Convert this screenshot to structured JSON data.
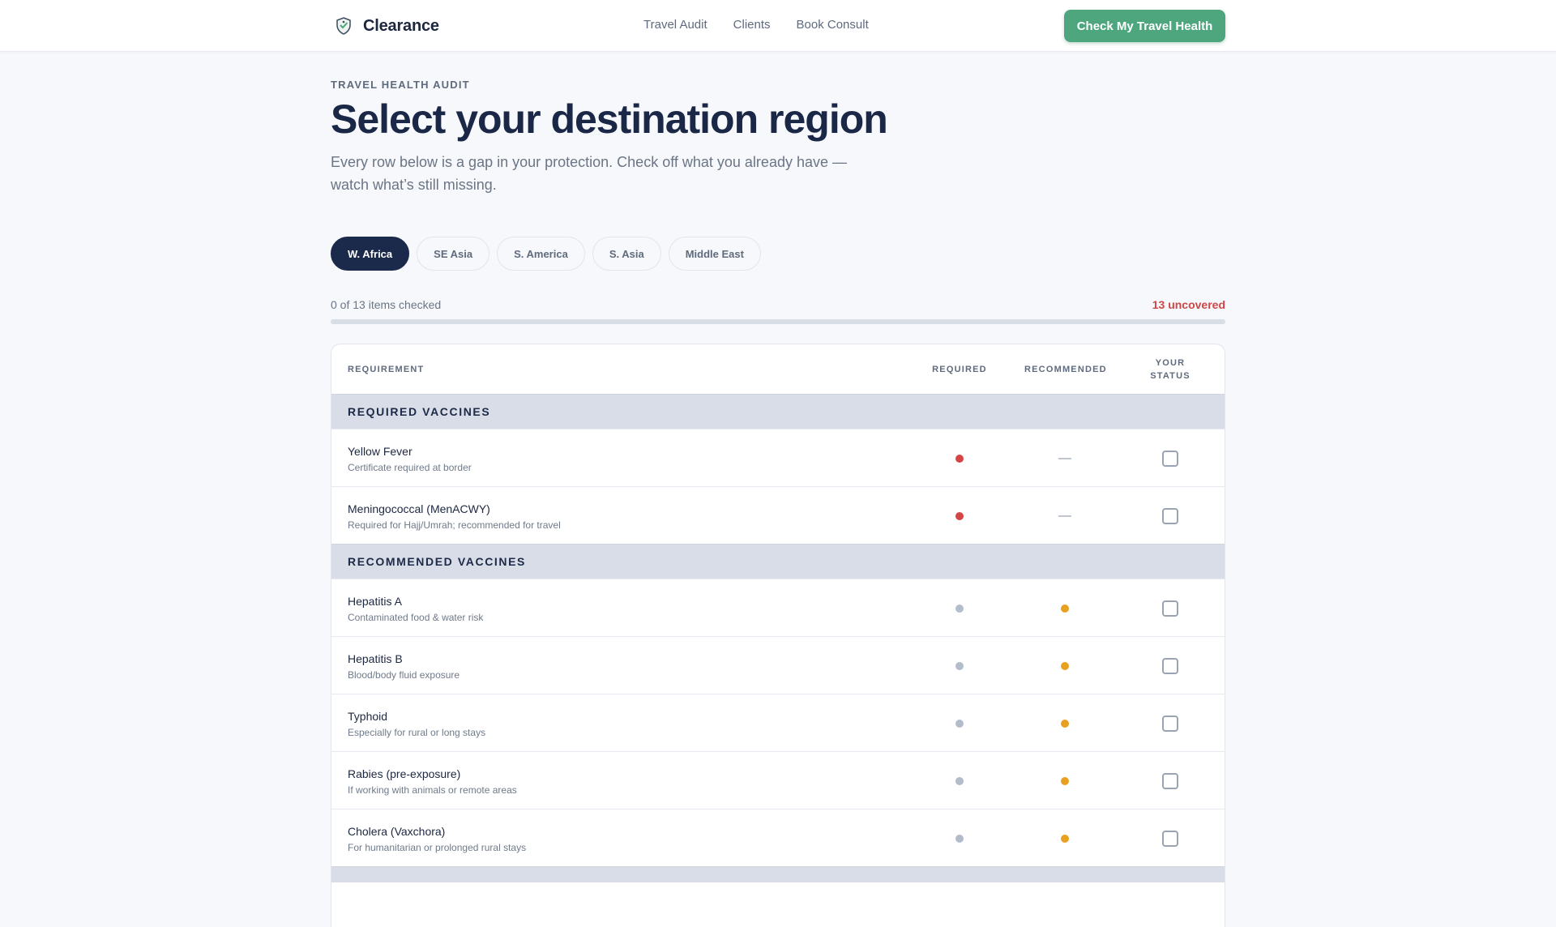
{
  "brand": {
    "name": "Clearance",
    "logo_icon": "shield-logo-icon"
  },
  "nav": {
    "items": [
      "Travel Audit",
      "Clients",
      "Book Consult"
    ]
  },
  "cta": {
    "label": "Check My Travel Health"
  },
  "hero": {
    "eyebrow": "TRAVEL HEALTH AUDIT",
    "title": "Select your destination region",
    "subtitle": "Every row below is a gap in your protection. Check off what you already have — watch what’s still missing."
  },
  "regions": {
    "selected": "W. Africa",
    "tabs": [
      "W. Africa",
      "SE Asia",
      "S. America",
      "S. Asia",
      "Middle East"
    ]
  },
  "progress": {
    "label": "0 of 13 items checked",
    "uncovered": "13 uncovered",
    "checked": 0,
    "total": 13
  },
  "table": {
    "headers": {
      "requirement": "REQUIREMENT",
      "required": "REQUIRED",
      "recommended": "RECOMMENDED",
      "status": "YOUR STATUS"
    },
    "groups": [
      {
        "title": "REQUIRED VACCINES",
        "rows": [
          {
            "name": "Yellow Fever",
            "note": "Certificate required at border",
            "required": "yes",
            "recommended": "—",
            "checked": false
          },
          {
            "name": "Meningococcal (MenACWY)",
            "note": "Required for Hajj/Umrah; recommended for travel",
            "required": "yes",
            "recommended": "—",
            "checked": false
          }
        ]
      },
      {
        "title": "RECOMMENDED VACCINES",
        "rows": [
          {
            "name": "Hepatitis A",
            "note": "Contaminated food & water risk",
            "required": "no",
            "recommended": "yes",
            "checked": false
          },
          {
            "name": "Hepatitis B",
            "note": "Blood/body fluid exposure",
            "required": "no",
            "recommended": "yes",
            "checked": false
          },
          {
            "name": "Typhoid",
            "note": "Especially for rural or long stays",
            "required": "no",
            "recommended": "yes",
            "checked": false
          },
          {
            "name": "Rabies (pre-exposure)",
            "note": "If working with animals or remote areas",
            "required": "no",
            "recommended": "yes",
            "checked": false
          },
          {
            "name": "Cholera (Vaxchora)",
            "note": "For humanitarian or prolonged rural stays",
            "required": "no",
            "recommended": "yes",
            "checked": false
          }
        ]
      }
    ]
  },
  "colors": {
    "required_dot": "#d64545",
    "recommended_dot": "#e8a020",
    "inactive_dot": "#b3bccb",
    "accent": "#4ea67f",
    "navy": "#1b2a4b"
  }
}
